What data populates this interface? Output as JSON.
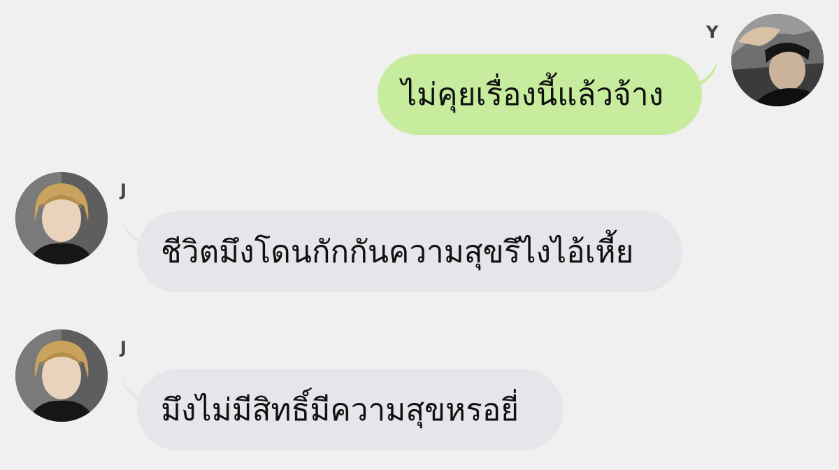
{
  "messages": [
    {
      "sender": "Y",
      "text": "ไม่คุยเรื่องนี้แล้วจ้าง",
      "direction": "outgoing",
      "bubble_color": "#c7ec9e"
    },
    {
      "sender": "J",
      "text": "ชีวิตมึงโดนกักกันความสุขรึไงไอ้เหี้ย",
      "direction": "incoming",
      "bubble_color": "#e4e6ea"
    },
    {
      "sender": "J",
      "text": "มึงไม่มีสิทธิ์มีความสุขหรอยี่",
      "direction": "incoming",
      "bubble_color": "#e4e6ea"
    }
  ],
  "colors": {
    "background": "#f0f0f0",
    "sender_text": "#444444"
  }
}
